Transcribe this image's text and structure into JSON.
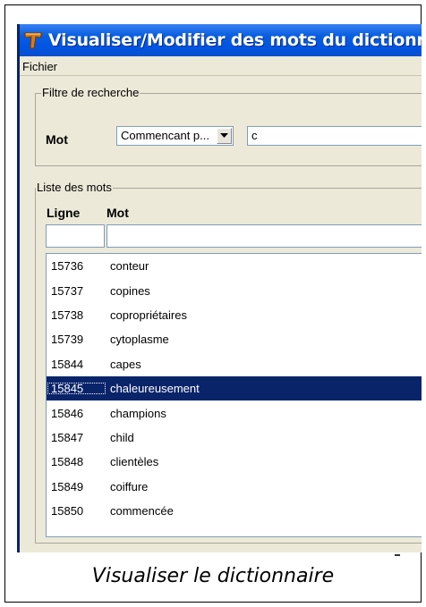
{
  "window": {
    "title": "Visualiser/Modifier des mots du dictionnaire",
    "icon": "hammer-app-icon"
  },
  "menu": {
    "items": [
      "Fichier"
    ]
  },
  "filter": {
    "group_label": "Filtre de recherche",
    "field_label": "Mot",
    "mode_selected": "Commencant p...",
    "search_value": "c"
  },
  "list": {
    "group_label": "Liste des mots",
    "columns": [
      "Ligne",
      "Mot"
    ],
    "rows": [
      {
        "line": "15736",
        "word": "conteur"
      },
      {
        "line": "15737",
        "word": "copines"
      },
      {
        "line": "15738",
        "word": "copropriétaires"
      },
      {
        "line": "15739",
        "word": "cytoplasme"
      },
      {
        "line": "15844",
        "word": "capes"
      },
      {
        "line": "15845",
        "word": "chaleureusement"
      },
      {
        "line": "15846",
        "word": "champions"
      },
      {
        "line": "15847",
        "word": "child"
      },
      {
        "line": "15848",
        "word": "clientèles"
      },
      {
        "line": "15849",
        "word": "coiffure"
      },
      {
        "line": "15850",
        "word": "commencée"
      }
    ],
    "selected_line": "15845"
  },
  "caption": "Visualiser le dictionnaire",
  "colors": {
    "title_blue": "#0054e3",
    "selection": "#0a246a",
    "window_bg": "#ece9d8"
  }
}
